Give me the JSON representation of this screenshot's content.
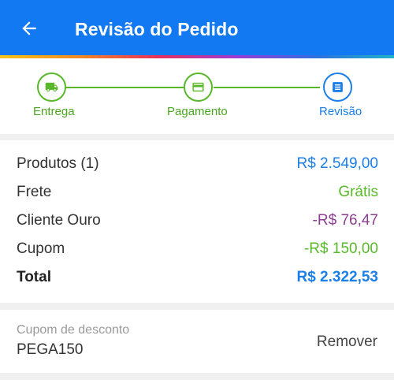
{
  "header": {
    "title": "Revisão do Pedido",
    "back_icon": "arrow-left-icon"
  },
  "colors": {
    "primary": "#1279f2",
    "green": "#58b82a",
    "blue": "#1a7fe8",
    "purple": "#8e3e92"
  },
  "stepper": {
    "steps": [
      {
        "label": "Entrega",
        "icon": "truck-icon",
        "state": "completed"
      },
      {
        "label": "Pagamento",
        "icon": "credit-card-icon",
        "state": "completed"
      },
      {
        "label": "Revisão",
        "icon": "list-icon",
        "state": "current"
      }
    ]
  },
  "summary": {
    "products": {
      "label": "Produtos (1)",
      "value": "R$ 2.549,00",
      "color": "#1a7fe8"
    },
    "shipping": {
      "label": "Frete",
      "value": "Grátis",
      "color": "#58b82a"
    },
    "gold_client": {
      "label": "Cliente Ouro",
      "value": "-R$ 76,47",
      "color": "#8e3e92"
    },
    "coupon": {
      "label": "Cupom",
      "value": "-R$ 150,00",
      "color": "#58b82a"
    },
    "total": {
      "label": "Total",
      "value": "R$ 2.322,53",
      "color": "#1a7fe8"
    }
  },
  "coupon_section": {
    "label": "Cupom de desconto",
    "code": "PEGA150",
    "remove_label": "Remover"
  }
}
